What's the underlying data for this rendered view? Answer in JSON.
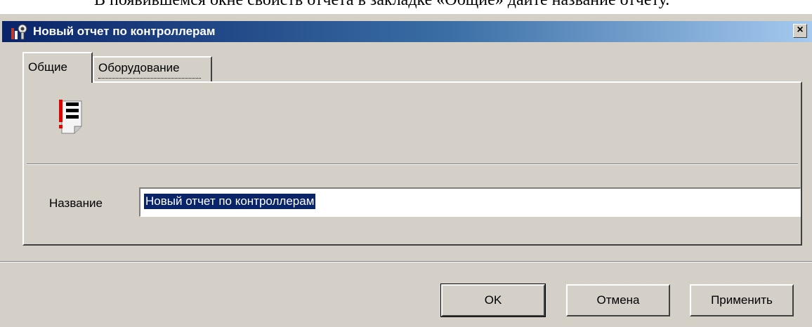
{
  "background_text": "В появившемся окне свойств отчета в закладке «Общие» дайте название отчету.",
  "window": {
    "title": "Новый отчет по контроллерам",
    "close_label": "×"
  },
  "tabs": [
    {
      "label": "Общие",
      "active": true
    },
    {
      "label": "Оборудование",
      "active": false
    }
  ],
  "form": {
    "name_label": "Название",
    "name_value": "Новый отчет по контроллерам"
  },
  "buttons": {
    "ok": "OK",
    "cancel": "Отмена",
    "apply": "Применить"
  },
  "colors": {
    "titlebar_start": "#0a246a",
    "titlebar_end": "#a6caf0",
    "window_face": "#d4d0c8",
    "selection": "#0a246a"
  },
  "icons": {
    "title": "report-gear-icon",
    "report": "report-document-icon",
    "close": "close-icon"
  }
}
